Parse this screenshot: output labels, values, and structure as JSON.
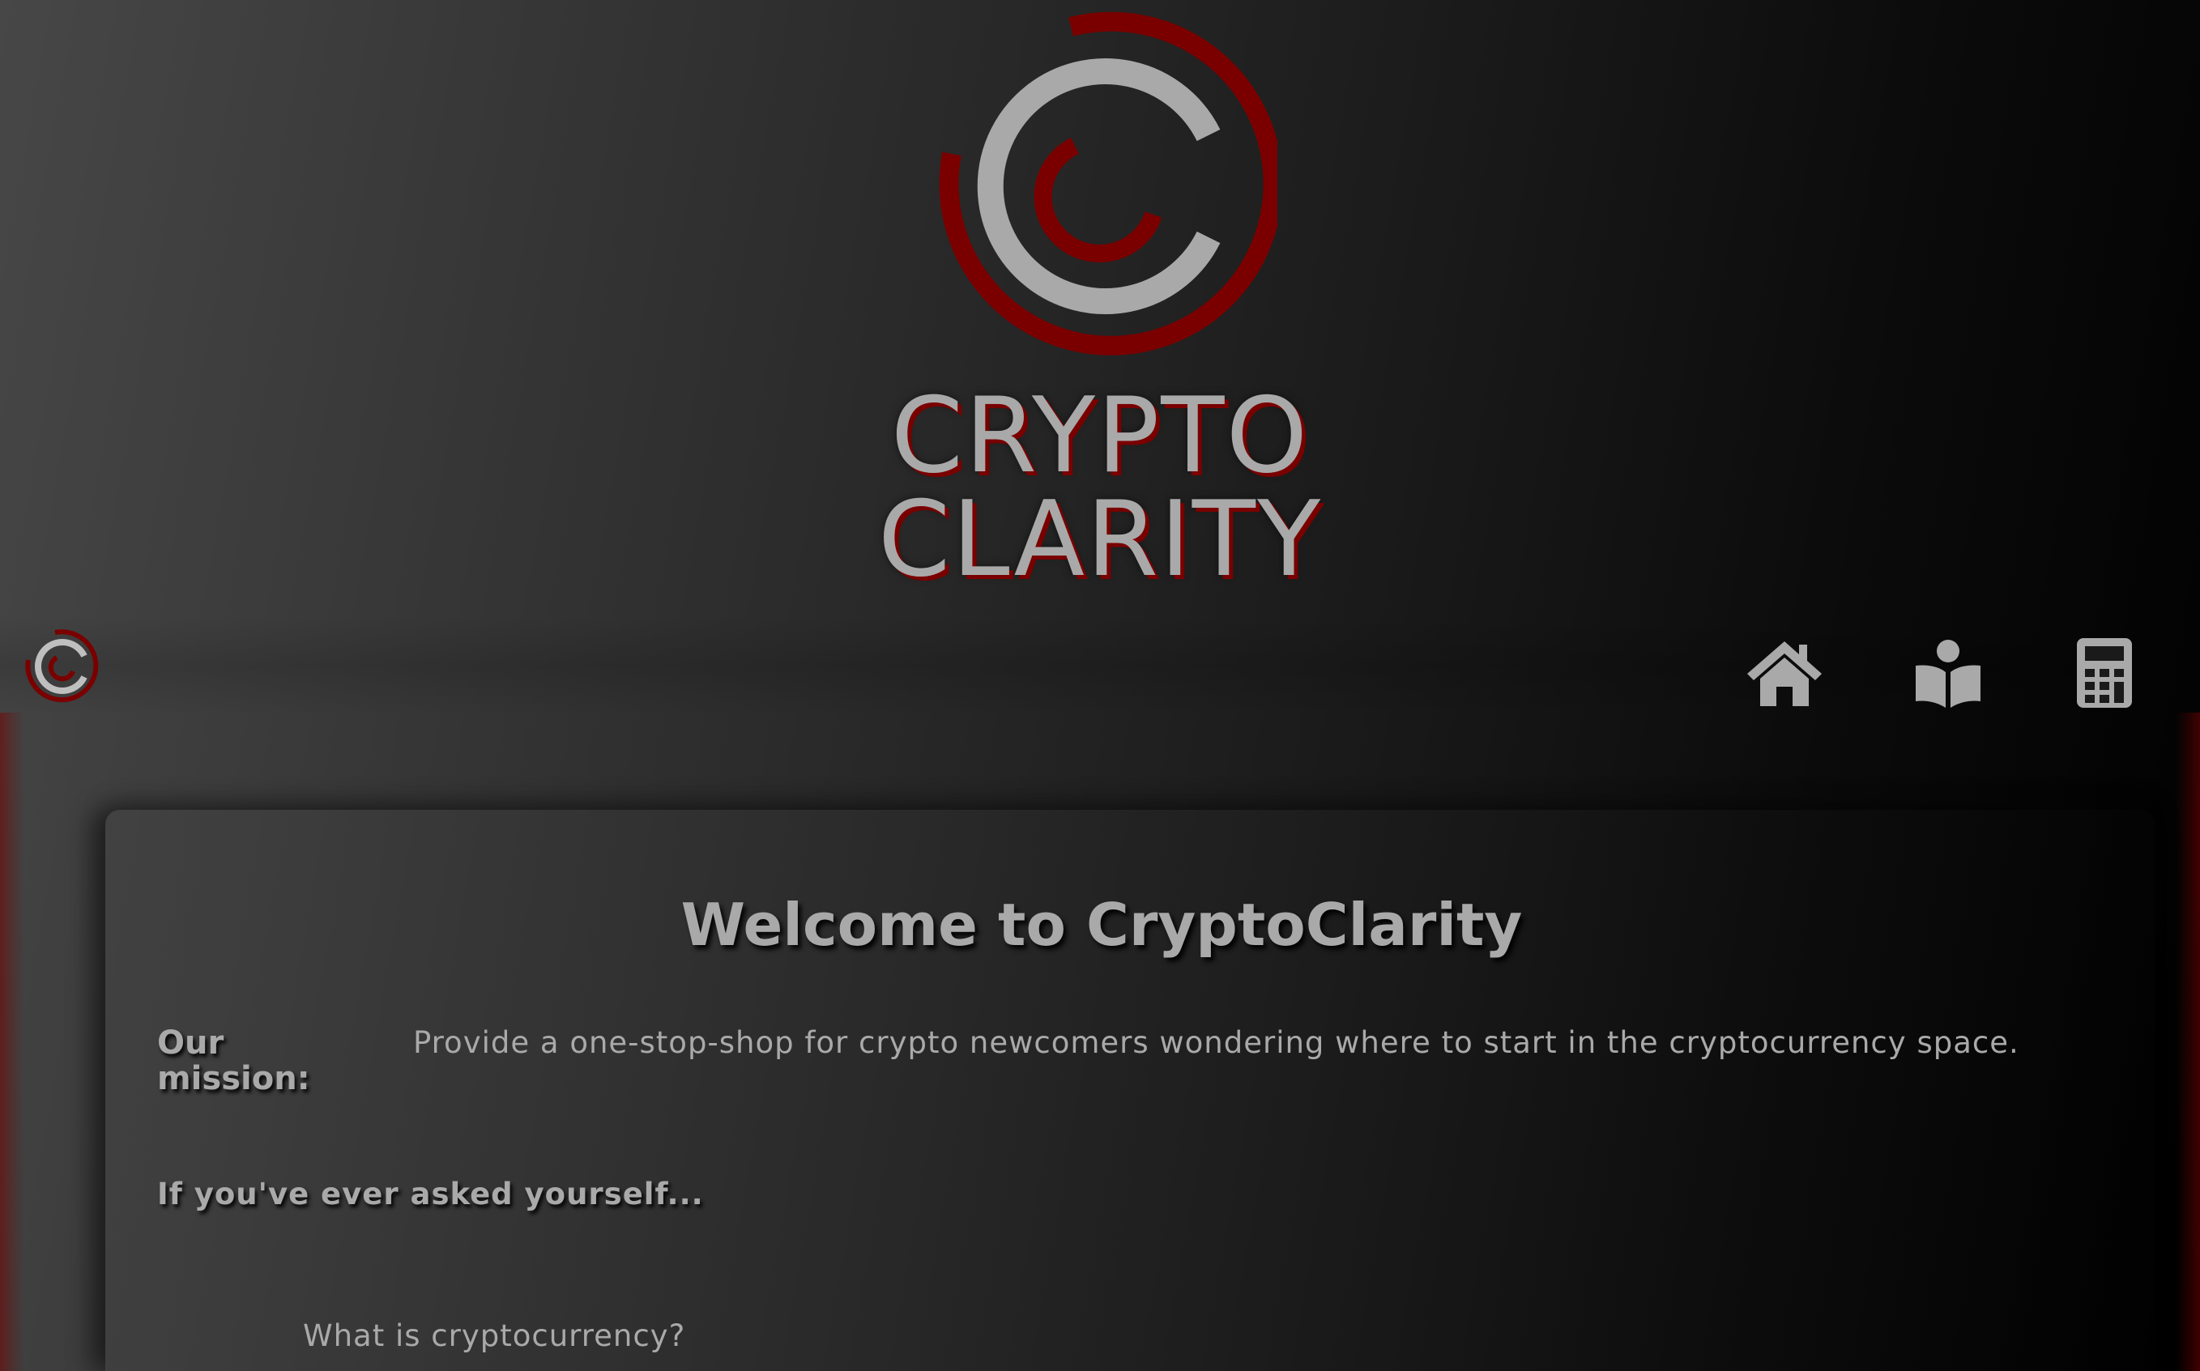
{
  "hero": {
    "logo_icon": "crypto-clarity-logo-icon",
    "title_line1": "CRYPTO",
    "title_line2": "CLARITY"
  },
  "nav": {
    "logo_icon": "crypto-clarity-logo-icon",
    "items": [
      {
        "icon": "home-icon"
      },
      {
        "icon": "reader-book-icon"
      },
      {
        "icon": "calculator-icon"
      }
    ]
  },
  "main": {
    "heading": "Welcome to CryptoClarity",
    "mission_label": "Our mission:",
    "mission_text": "Provide a one-stop-shop for crypto newcomers wondering where to start in the cryptocurrency space.",
    "prompt": "If you've ever asked yourself...",
    "questions": [
      "What is cryptocurrency?"
    ]
  },
  "colors": {
    "accent_red": "#7a0000",
    "text_gray": "#a9a9a9",
    "background_dark": "#000000",
    "background_light": "#474747"
  }
}
